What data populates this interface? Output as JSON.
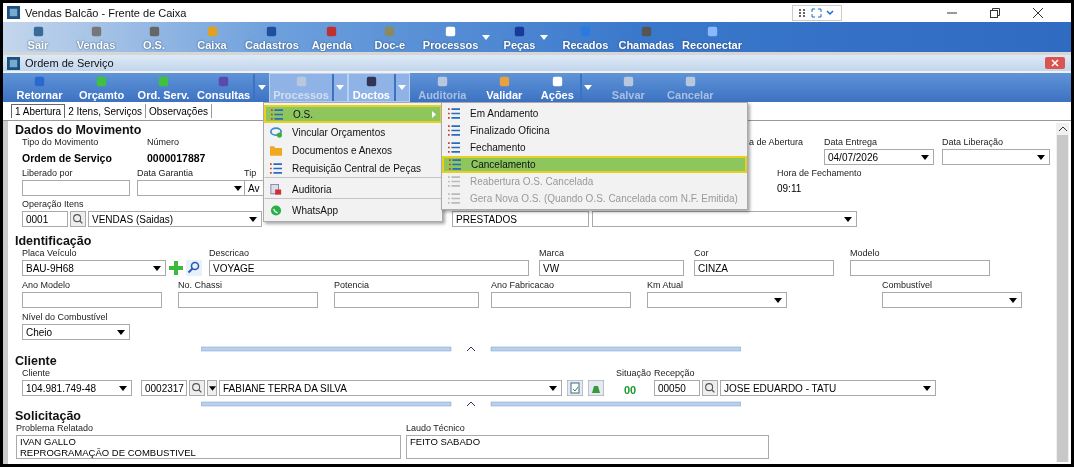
{
  "window": {
    "title": "Vendas Balcão - Frente de Caixa"
  },
  "main_toolbar": [
    {
      "label": "Sair",
      "dropdown": false
    },
    {
      "label": "Vendas",
      "dropdown": false
    },
    {
      "label": "O.S.",
      "dropdown": false
    },
    {
      "label": "Caixa",
      "dropdown": false
    },
    {
      "label": "Cadastros",
      "dropdown": false
    },
    {
      "label": "Agenda",
      "dropdown": false
    },
    {
      "label": "Doc-e",
      "dropdown": false
    },
    {
      "label": "Processos",
      "dropdown": true
    },
    {
      "label": "Peças",
      "dropdown": true
    },
    {
      "label": "Recados",
      "dropdown": false
    },
    {
      "label": "Chamadas",
      "dropdown": false
    },
    {
      "label": "Reconectar",
      "dropdown": false
    }
  ],
  "child_window": {
    "title": "Ordem de Serviço"
  },
  "toolbar": [
    {
      "label": "Retornar",
      "dropdown": false,
      "pressed": false,
      "disabled": false
    },
    {
      "label": "Orçamto",
      "dropdown": false,
      "pressed": false,
      "disabled": false
    },
    {
      "label": "Ord. Serv.",
      "dropdown": false,
      "pressed": false,
      "disabled": false
    },
    {
      "label": "Consultas",
      "dropdown": true,
      "pressed": false,
      "disabled": false
    },
    {
      "label": "Processos",
      "dropdown": true,
      "pressed": true,
      "disabled": true
    },
    {
      "label": "Doctos",
      "dropdown": true,
      "pressed": true,
      "disabled": false
    },
    {
      "label": "Auditoria",
      "dropdown": false,
      "pressed": false,
      "disabled": true
    },
    {
      "label": "Validar",
      "dropdown": false,
      "pressed": false,
      "disabled": false
    },
    {
      "label": "Ações",
      "dropdown": true,
      "pressed": false,
      "disabled": false
    },
    {
      "label": "Salvar",
      "dropdown": false,
      "pressed": false,
      "disabled": true
    },
    {
      "label": "Cancelar",
      "dropdown": false,
      "pressed": false,
      "disabled": true
    }
  ],
  "tabs": [
    {
      "label": "1 Abertura",
      "selected": true
    },
    {
      "label": "2 Itens, Serviços",
      "selected": false
    },
    {
      "label": "Observações",
      "selected": false
    }
  ],
  "sections": [
    {
      "title": "Dados do Movimento",
      "rows": [
        [
          {
            "kind": "static-bold",
            "label": "Tipo do Movimento",
            "value": "Ordem de Serviço"
          },
          {
            "kind": "static-bold",
            "label": "Número",
            "value": "0000017887"
          },
          {
            "kind": "static",
            "label": "a de Abertura"
          },
          {
            "kind": "select",
            "label": "Data Entrega",
            "value": "04/07/2026"
          },
          {
            "kind": "select",
            "label": "Data Liberação"
          }
        ],
        [
          {
            "kind": "text",
            "label": "Liberado por"
          },
          {
            "kind": "select",
            "label": "Data Garantia"
          },
          {
            "kind": "select",
            "label": "Tip",
            "value": "Av"
          },
          {
            "kind": "static",
            "label": "Hora de Fechamento",
            "value": "09:11"
          }
        ],
        [
          {
            "kind": "lookup",
            "label": "Operação Itens",
            "code": "0001",
            "value": "VENDAS (Saidas)"
          },
          {
            "kind": "text",
            "value": "PRESTADOS"
          },
          {
            "kind": "select"
          }
        ]
      ]
    },
    {
      "title": "Identificação",
      "rows": [
        [
          {
            "kind": "select",
            "label": "Placa Veículo",
            "value": "BAU-9H68"
          },
          {
            "kind": "text",
            "label": "Descricao",
            "value": "VOYAGE"
          },
          {
            "kind": "text",
            "label": "Marca",
            "value": "VW"
          },
          {
            "kind": "text",
            "label": "Cor",
            "value": "CINZA"
          },
          {
            "kind": "text",
            "label": "Modelo"
          }
        ],
        [
          {
            "kind": "text",
            "label": "Ano Modelo"
          },
          {
            "kind": "text",
            "label": "No. Chassi"
          },
          {
            "kind": "text",
            "label": "Potencia"
          },
          {
            "kind": "text",
            "label": "Ano Fabricacao"
          },
          {
            "kind": "select",
            "label": "Km Atual"
          },
          {
            "kind": "select",
            "label": "Combustível"
          }
        ],
        [
          {
            "kind": "select",
            "label": "Nível do Combustível",
            "value": "Cheio"
          }
        ]
      ]
    },
    {
      "title": "Cliente",
      "rows": [
        [
          {
            "kind": "select",
            "label": "Cliente",
            "value": "104.981.749-48"
          },
          {
            "kind": "lookup-drop",
            "code": "0002317",
            "value": "FABIANE TERRA DA SILVA"
          },
          {
            "kind": "status",
            "label": "Situação",
            "value": "00"
          },
          {
            "kind": "lookup",
            "label": "Recepção",
            "code": "00050",
            "value": "JOSE EDUARDO - TATU"
          }
        ]
      ]
    },
    {
      "title": "Solicitação",
      "rows": [
        [
          {
            "kind": "memo",
            "label": "Problema Relatado",
            "lines": [
              "IVAN GALLO",
              "REPROGRAMAÇÃO DE COMBUSTIVEL"
            ]
          },
          {
            "kind": "memo",
            "label": "Laudo Técnico",
            "lines": [
              "FEITO SABADO"
            ]
          }
        ]
      ]
    }
  ],
  "menu": [
    {
      "label": "O.S.",
      "kind": "list",
      "selected": true,
      "submenu": true,
      "separator_before": false
    },
    {
      "label": "Vincular Orçamentos",
      "kind": "link",
      "selected": false,
      "submenu": false,
      "separator_before": false
    },
    {
      "label": "Documentos e Anexos",
      "kind": "folder",
      "selected": false,
      "submenu": false,
      "separator_before": false
    },
    {
      "label": "Requisição Central de Peças",
      "kind": "list",
      "selected": false,
      "submenu": false,
      "separator_before": false
    },
    {
      "label": "Auditoria",
      "kind": "audit",
      "selected": false,
      "submenu": false,
      "separator_before": true
    },
    {
      "label": "WhatsApp",
      "kind": "chat",
      "selected": false,
      "submenu": false,
      "separator_before": true
    }
  ],
  "submenu": [
    {
      "label": "Em Andamento",
      "selected": false,
      "disabled": false
    },
    {
      "label": "Finalizado Oficina",
      "selected": false,
      "disabled": false
    },
    {
      "label": "Fechamento",
      "selected": false,
      "disabled": false
    },
    {
      "label": "Cancelamento",
      "selected": true,
      "disabled": false
    },
    {
      "label": "Reabertura O.S. Cancelada",
      "selected": false,
      "disabled": true
    },
    {
      "label": "Gera Nova O.S. (Quando O.S. Cancelada com N.F. Emitida)",
      "selected": false,
      "disabled": true
    }
  ]
}
